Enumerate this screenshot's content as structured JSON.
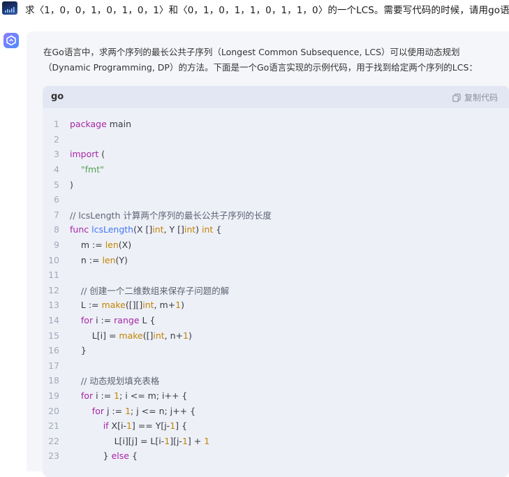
{
  "user": {
    "message": "求〈1，0，0，1，0，1，0，1〉和〈0，1，0，1，1，0，1，1，0〉的一个LCS。需要写代码的时候，请用go语言。"
  },
  "assistant": {
    "intro_line1": "在Go语言中，求两个序列的最长公共子序列（Longest Common Subsequence, LCS）可以使用动态规划",
    "intro_line2": "（Dynamic Programming, DP）的方法。下面是一个Go语言实现的示例代码，用于找到给定两个序列的LCS：",
    "code_block": {
      "language": "go",
      "copy_label": "复制代码",
      "lines": [
        {
          "num": "1",
          "text": "package main"
        },
        {
          "num": "2",
          "text": ""
        },
        {
          "num": "3",
          "text": "import ("
        },
        {
          "num": "4",
          "text": "    \"fmt\""
        },
        {
          "num": "5",
          "text": ")"
        },
        {
          "num": "6",
          "text": ""
        },
        {
          "num": "7",
          "text": "// lcsLength 计算两个序列的最长公共子序列的长度"
        },
        {
          "num": "8",
          "text": "func lcsLength(X []int, Y []int) int {"
        },
        {
          "num": "9",
          "text": "    m := len(X)"
        },
        {
          "num": "10",
          "text": "    n := len(Y)"
        },
        {
          "num": "11",
          "text": ""
        },
        {
          "num": "12",
          "text": "    // 创建一个二维数组来保存子问题的解"
        },
        {
          "num": "13",
          "text": "    L := make([][]int, m+1)"
        },
        {
          "num": "14",
          "text": "    for i := range L {"
        },
        {
          "num": "15",
          "text": "        L[i] = make([]int, n+1)"
        },
        {
          "num": "16",
          "text": "    }"
        },
        {
          "num": "17",
          "text": ""
        },
        {
          "num": "18",
          "text": "    // 动态规划填充表格"
        },
        {
          "num": "19",
          "text": "    for i := 1; i <= m; i++ {"
        },
        {
          "num": "20",
          "text": "        for j := 1; j <= n; j++ {"
        },
        {
          "num": "21",
          "text": "            if X[i-1] == Y[j-1] {"
        },
        {
          "num": "22",
          "text": "                L[i][j] = L[i-1][j-1] + 1"
        },
        {
          "num": "23",
          "text": "            } else {"
        }
      ]
    }
  }
}
